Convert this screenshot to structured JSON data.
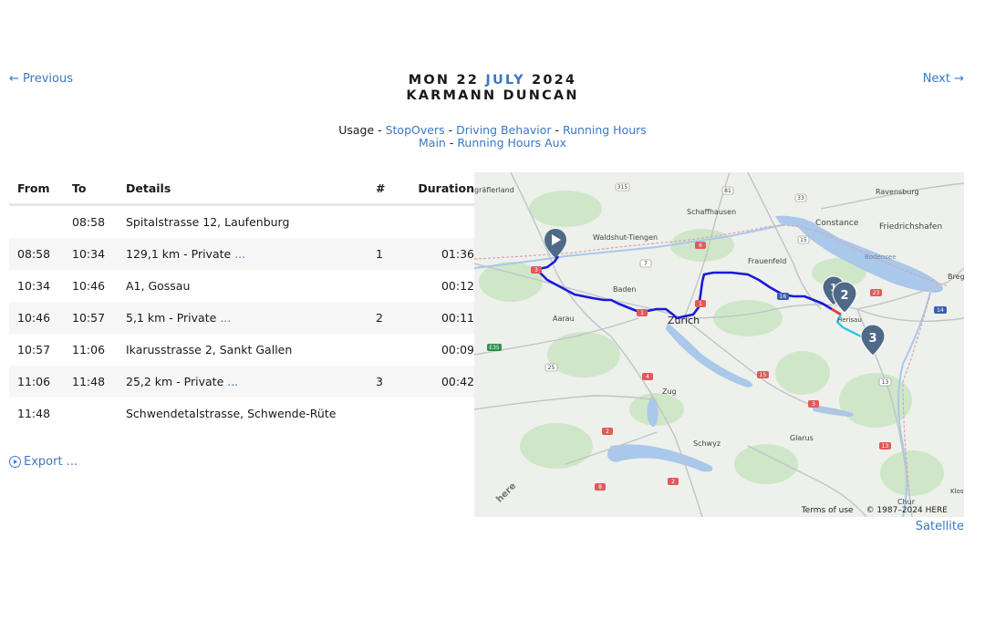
{
  "nav": {
    "previous": "← Previous",
    "next": "Next →"
  },
  "header": {
    "day": "MON 22",
    "month": "JULY",
    "year": "2024",
    "driver": "KARMANN DUNCAN"
  },
  "links": {
    "usage_prefix": "Usage - ",
    "stopovers": "StopOvers",
    "sep": " - ",
    "driving_behavior": "Driving Behavior",
    "running_hours": "Running Hours",
    "main": "Main",
    "running_hours_aux": "Running Hours Aux"
  },
  "table": {
    "headers": {
      "from": "From",
      "to": "To",
      "details": "Details",
      "num": "#",
      "duration": "Duration"
    },
    "rows": [
      {
        "from": "",
        "to": "08:58",
        "details": "Spitalstrasse 12, Laufenburg",
        "more": "",
        "num": "",
        "duration": ""
      },
      {
        "from": "08:58",
        "to": "10:34",
        "details": "129,1 km - Private",
        "more": "...",
        "num": "1",
        "duration": "01:36"
      },
      {
        "from": "10:34",
        "to": "10:46",
        "details": "A1, Gossau",
        "more": "",
        "num": "",
        "duration": "00:12"
      },
      {
        "from": "10:46",
        "to": "10:57",
        "details": "5,1 km - Private",
        "more": "...",
        "num": "2",
        "duration": "00:11"
      },
      {
        "from": "10:57",
        "to": "11:06",
        "details": "Ikarusstrasse 2, Sankt Gallen",
        "more": "",
        "num": "",
        "duration": "00:09"
      },
      {
        "from": "11:06",
        "to": "11:48",
        "details": "25,2 km - Private",
        "more": "...",
        "num": "3",
        "duration": "00:42"
      },
      {
        "from": "11:48",
        "to": "",
        "details": "Schwendetalstrasse, Schwende-Rüte",
        "more": "",
        "num": "",
        "duration": ""
      }
    ]
  },
  "export": {
    "label": "Export ...",
    "icon": "play-circle-icon"
  },
  "map": {
    "places": {
      "ravensburg": "Ravensburg",
      "schaffhausen": "Schaffhausen",
      "constance": "Constance",
      "friedrichshafen": "Friedrichshafen",
      "waldshut": "Waldshut-Tiengen",
      "graefler": "gräflerland",
      "bodensee": "Bodensee",
      "frauenfeld": "Frauenfeld",
      "breg": "Breg",
      "baden": "Baden",
      "zurich": "Zurich",
      "aarau": "Aarau",
      "herisau": "Herisau",
      "zug": "Zug",
      "schwyz": "Schwyz",
      "glarus": "Glarus",
      "chur": "Chur",
      "klos": "Klos",
      "here_logo": "here"
    },
    "shields": {
      "a315": "315",
      "a81": "81",
      "a33": "33",
      "a15": "15",
      "a6": "6",
      "a7": "7",
      "a3": "3",
      "a1a": "1",
      "a1b": "1",
      "a16": "16",
      "a23": "23",
      "a14": "14",
      "a1c": "1",
      "a4": "4",
      "a15b": "15",
      "a2": "2",
      "a2b": "2",
      "a8": "8",
      "a13": "13",
      "a13b": "13",
      "a3b": "3",
      "a25": "25",
      "a36": "E35"
    },
    "markers": {
      "start": "play-marker-icon",
      "m1": "1",
      "m2": "2",
      "m3": "3"
    },
    "colors": {
      "route_main": "#1a1ad8",
      "route_end": "#22c3e6",
      "route_stop": "#e63b3b",
      "marker": "#4e6a87",
      "water": "#a9c8ea"
    },
    "footer": {
      "terms": "Terms of use",
      "copyright": "© 1987–2024 HERE"
    },
    "satellite": "Satellite"
  }
}
